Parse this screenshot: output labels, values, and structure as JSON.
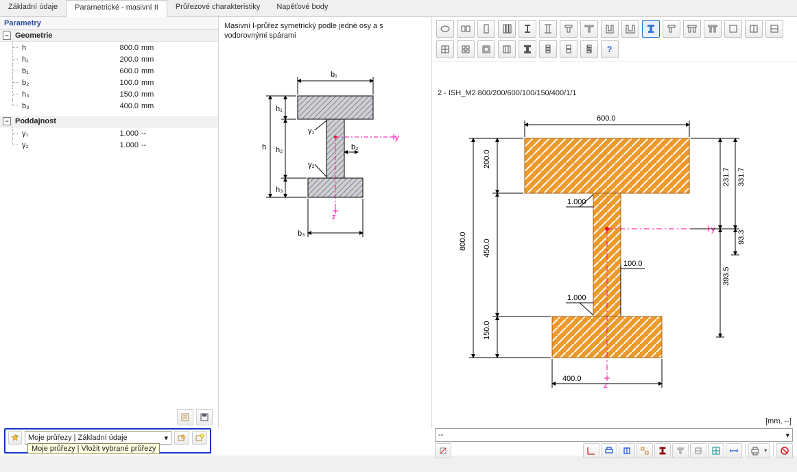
{
  "tabs": {
    "t0": "Základní údaje",
    "t1": "Parametrické - masivní II",
    "t2": "Průřezové charakteristiky",
    "t3": "Napěťové body"
  },
  "panel": {
    "title": "Parametry",
    "group_geom": "Geometrie",
    "group_compl": "Poddajnost"
  },
  "geom": [
    {
      "name": "h",
      "val": "800.0",
      "unit": "mm"
    },
    {
      "name": "h₁",
      "val": "200.0",
      "unit": "mm"
    },
    {
      "name": "b₁",
      "val": "600.0",
      "unit": "mm"
    },
    {
      "name": "b₂",
      "val": "100.0",
      "unit": "mm"
    },
    {
      "name": "h₃",
      "val": "150.0",
      "unit": "mm"
    },
    {
      "name": "b₃",
      "val": "400.0",
      "unit": "mm"
    }
  ],
  "compl": [
    {
      "name": "γ₁",
      "val": "1.000",
      "unit": "--"
    },
    {
      "name": "γ₂",
      "val": "1.000",
      "unit": "--"
    }
  ],
  "mid": {
    "desc": "Masivní I-průřez symetrický podle jedné osy a s vodorovnými spárami"
  },
  "mid_labels": {
    "b1": "b₁",
    "h1": "h₁",
    "h": "h",
    "h2": "h₂",
    "h3": "h₃",
    "b2": "b₂",
    "b3": "b₃",
    "g1": "γ₁",
    "g2": "γ₂",
    "y": "y",
    "z": "z"
  },
  "right": {
    "title": "2 - ISH_M2 800/200/600/100/150/400/1/1",
    "units": "[mm, --]",
    "status": "--"
  },
  "right_dims": {
    "top": "600.0",
    "left_h": "800.0",
    "left_h1": "200.0",
    "left_h2": "450.0",
    "left_h3": "150.0",
    "g1": "1.000",
    "g2": "1.000",
    "b2": "100.0",
    "b3": "400.0",
    "r1": "231.7",
    "r2": "331.7",
    "r3": "393.5",
    "r4": "93.3",
    "y": "y",
    "z": "z"
  },
  "fav": {
    "select": "Moje průřezy | Základní údaje",
    "tooltip": "Moje průřezy | Vložit vybrané průřezy"
  }
}
